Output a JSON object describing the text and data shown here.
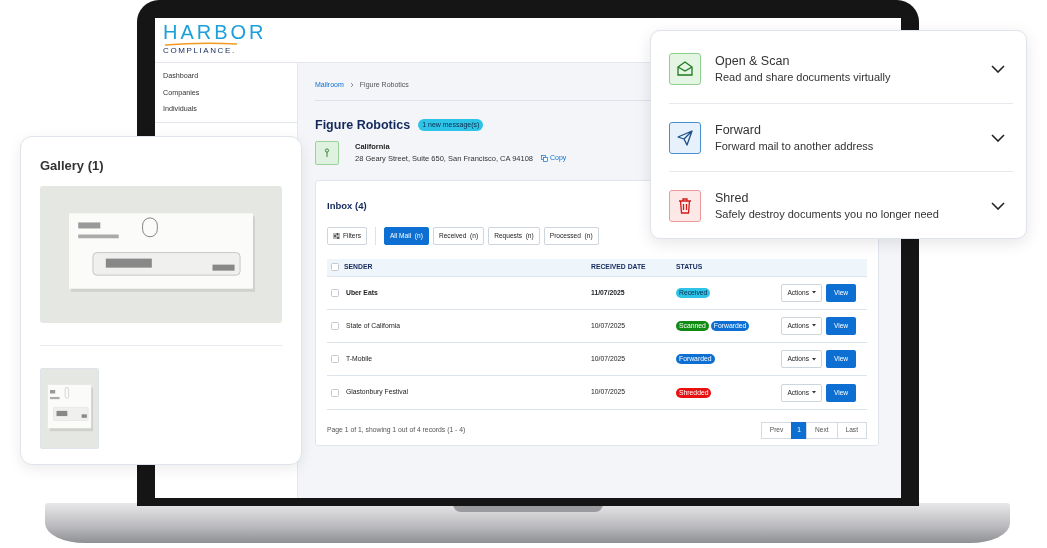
{
  "logo": {
    "line1": "HARBOR",
    "line2": "COMPLIANCE."
  },
  "sidebar": {
    "items": [
      {
        "label": "Dashboard"
      },
      {
        "label": "Companies"
      },
      {
        "label": "Individuals"
      }
    ]
  },
  "breadcrumb": [
    "Mailroom",
    "Figure Robotics"
  ],
  "company": {
    "name": "Figure Robotics",
    "badge": "1 new message(s)",
    "state": "California",
    "address": "28 Geary Street, Suite 650, San Francisco, CA 94108",
    "copy": "Copy"
  },
  "inbox": {
    "title": "Inbox (4)",
    "filters_button": "Filters",
    "tabs": [
      {
        "label": "All Mail",
        "count": "(n)",
        "selected": true
      },
      {
        "label": "Received",
        "count": "(n)",
        "selected": false
      },
      {
        "label": "Requests",
        "count": "(n)",
        "selected": false
      },
      {
        "label": "Processed",
        "count": "(n)",
        "selected": false
      }
    ],
    "header_checked": false,
    "columns": [
      "SENDER",
      "RECEIVED DATE",
      "STATUS"
    ],
    "rows": [
      {
        "sender": "Uber Eats",
        "date": "11/07/2025",
        "unread": true,
        "checked": false,
        "statuses": [
          {
            "label": "Received",
            "color": "#2ec4e8"
          }
        ],
        "actions": "Actions",
        "view": "View"
      },
      {
        "sender": "State of California",
        "date": "10/07/2025",
        "unread": false,
        "checked": false,
        "statuses": [
          {
            "label": "Scanned",
            "color": "#0f8a12"
          },
          {
            "label": "Forwarded",
            "color": "#0d6fd1"
          }
        ],
        "actions": "Actions",
        "view": "View"
      },
      {
        "sender": "T-Mobile",
        "date": "10/07/2025",
        "unread": false,
        "checked": false,
        "statuses": [
          {
            "label": "Forwarded",
            "color": "#0d6fd1"
          }
        ],
        "actions": "Actions",
        "view": "View"
      },
      {
        "sender": "Glastonbury Festival",
        "date": "10/07/2025",
        "unread": false,
        "checked": false,
        "statuses": [
          {
            "label": "Shredded",
            "color": "#e81010"
          }
        ],
        "actions": "Actions",
        "view": "View"
      }
    ],
    "footer": "Page 1 of 1, showing 1 out of 4 records (1 - 4)",
    "pagination": [
      {
        "label": "Prev",
        "selected": false
      },
      {
        "label": "1",
        "selected": true
      },
      {
        "label": "Next",
        "selected": false
      },
      {
        "label": "Last",
        "selected": false
      }
    ]
  },
  "gallery": {
    "title": "Gallery (1)"
  },
  "services": [
    {
      "kind": "scan",
      "title": "Open & Scan",
      "description": "Read and share documents virtually",
      "expanded": false
    },
    {
      "kind": "forward",
      "title": "Forward",
      "description": "Forward mail to another address",
      "expanded": false
    },
    {
      "kind": "shred",
      "title": "Shred",
      "description": "Safely destroy documents you no longer need",
      "expanded": false
    }
  ]
}
